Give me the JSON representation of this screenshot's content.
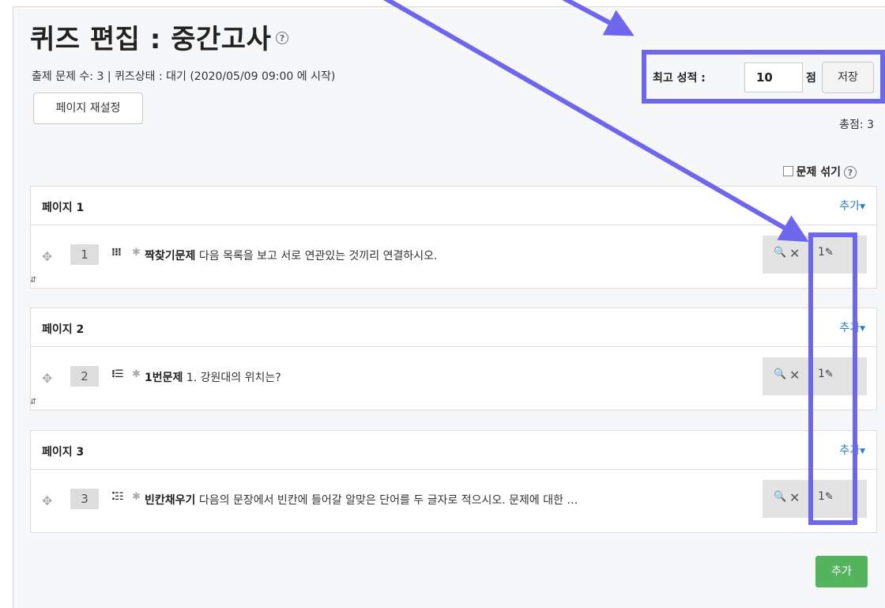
{
  "header": {
    "title": "퀴즈 편집 : 중간고사",
    "status": "출제 문제 수: 3 | 퀴즈상태 : 대기 (2020/05/09 09:00 에 시작)",
    "repaginate": "페이지 재설정",
    "help_glyph": "?"
  },
  "grade": {
    "label": "최고 성적 :",
    "value": "10",
    "unit": "점",
    "save": "저장",
    "total": "총점: 3"
  },
  "shuffle": {
    "label": "문제 섞기"
  },
  "pages": [
    {
      "title": "페이지 1",
      "add": "추가",
      "question": {
        "number": "1",
        "type_icon": "matching-icon",
        "name": "짝찾기문제",
        "text": "다음 목록을 보고 서로 연관있는 것끼리 연결하시오.",
        "mark": "1"
      }
    },
    {
      "title": "페이지 2",
      "add": "추가",
      "question": {
        "number": "2",
        "type_icon": "multichoice-icon",
        "name": "1번문제",
        "text": "1. 강원대의 위치는?",
        "mark": "1"
      }
    },
    {
      "title": "페이지 3",
      "add": "추가",
      "question": {
        "number": "3",
        "type_icon": "cloze-icon",
        "name": "빈칸채우기",
        "text": "다음의 문장에서 빈칸에 들어갈 알맞은 단어를 두 글자로 적으시오. 문제에 대한 …",
        "mark": "1"
      }
    }
  ],
  "footer": {
    "add": "추가"
  },
  "annotation_color": "#6f66ee"
}
